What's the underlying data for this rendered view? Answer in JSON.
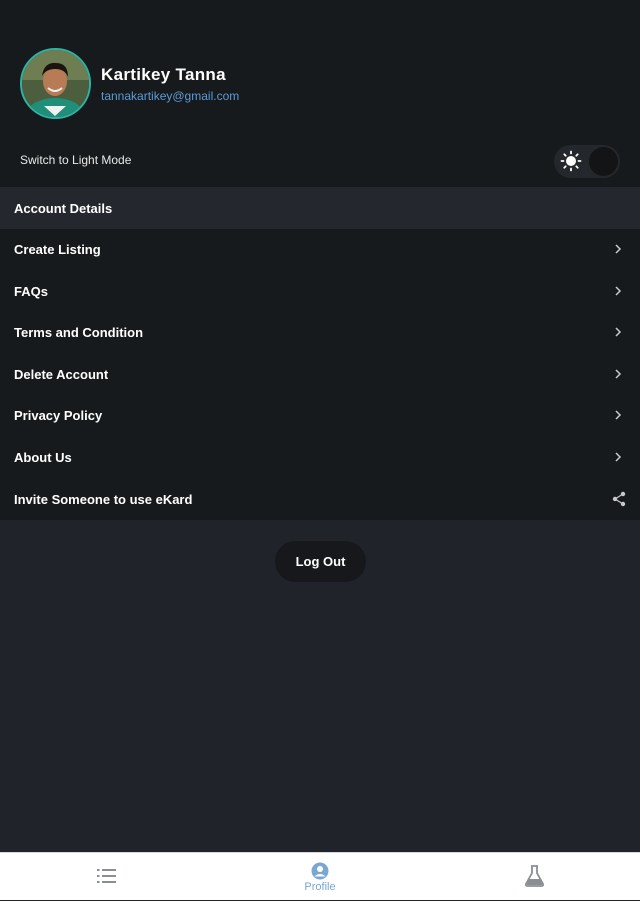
{
  "profile": {
    "name": "Kartikey Tanna",
    "email": "tannakartikey@gmail.com",
    "avatar_icon": "user-photo"
  },
  "theme_toggle": {
    "label": "Switch to Light Mode",
    "icon": "sun-icon",
    "state": "dark"
  },
  "section": {
    "title": "Account Details"
  },
  "menu": {
    "items": [
      {
        "label": "Create Listing",
        "icon": "chevron-right-icon"
      },
      {
        "label": "FAQs",
        "icon": "chevron-right-icon"
      },
      {
        "label": "Terms and Condition",
        "icon": "chevron-right-icon"
      },
      {
        "label": "Delete Account",
        "icon": "chevron-right-icon"
      },
      {
        "label": "Privacy Policy",
        "icon": "chevron-right-icon"
      },
      {
        "label": "About Us",
        "icon": "chevron-right-icon"
      },
      {
        "label": "Invite Someone to use eKard",
        "icon": "share-icon"
      }
    ]
  },
  "logout": {
    "label": "Log Out"
  },
  "bottom_nav": {
    "items": [
      {
        "icon": "list-icon",
        "label": ""
      },
      {
        "icon": "profile-icon",
        "label": "Profile",
        "active": true
      },
      {
        "icon": "flask-icon",
        "label": ""
      }
    ]
  },
  "colors": {
    "background": "#20232a",
    "panel": "#171a1c",
    "section_header": "#24282e",
    "email": "#5b9bd6",
    "avatar_border": "#2bb3a4",
    "nav_active": "#7aa7d0",
    "nav_inactive": "#8a8f96"
  }
}
